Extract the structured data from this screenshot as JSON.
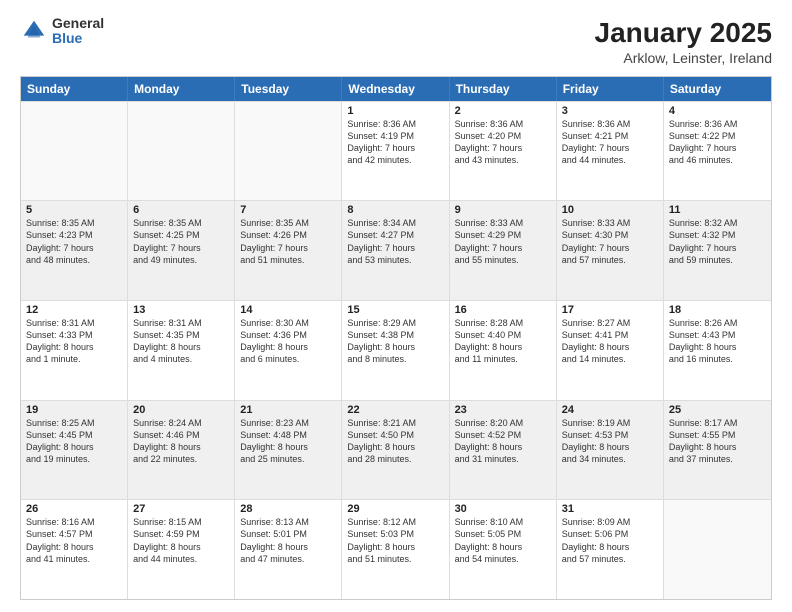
{
  "logo": {
    "general": "General",
    "blue": "Blue"
  },
  "header": {
    "title": "January 2025",
    "subtitle": "Arklow, Leinster, Ireland"
  },
  "weekdays": [
    "Sunday",
    "Monday",
    "Tuesday",
    "Wednesday",
    "Thursday",
    "Friday",
    "Saturday"
  ],
  "rows": [
    [
      {
        "day": "",
        "info": "",
        "empty": true
      },
      {
        "day": "",
        "info": "",
        "empty": true
      },
      {
        "day": "",
        "info": "",
        "empty": true
      },
      {
        "day": "1",
        "info": "Sunrise: 8:36 AM\nSunset: 4:19 PM\nDaylight: 7 hours\nand 42 minutes."
      },
      {
        "day": "2",
        "info": "Sunrise: 8:36 AM\nSunset: 4:20 PM\nDaylight: 7 hours\nand 43 minutes."
      },
      {
        "day": "3",
        "info": "Sunrise: 8:36 AM\nSunset: 4:21 PM\nDaylight: 7 hours\nand 44 minutes."
      },
      {
        "day": "4",
        "info": "Sunrise: 8:36 AM\nSunset: 4:22 PM\nDaylight: 7 hours\nand 46 minutes."
      }
    ],
    [
      {
        "day": "5",
        "info": "Sunrise: 8:35 AM\nSunset: 4:23 PM\nDaylight: 7 hours\nand 48 minutes."
      },
      {
        "day": "6",
        "info": "Sunrise: 8:35 AM\nSunset: 4:25 PM\nDaylight: 7 hours\nand 49 minutes."
      },
      {
        "day": "7",
        "info": "Sunrise: 8:35 AM\nSunset: 4:26 PM\nDaylight: 7 hours\nand 51 minutes."
      },
      {
        "day": "8",
        "info": "Sunrise: 8:34 AM\nSunset: 4:27 PM\nDaylight: 7 hours\nand 53 minutes."
      },
      {
        "day": "9",
        "info": "Sunrise: 8:33 AM\nSunset: 4:29 PM\nDaylight: 7 hours\nand 55 minutes."
      },
      {
        "day": "10",
        "info": "Sunrise: 8:33 AM\nSunset: 4:30 PM\nDaylight: 7 hours\nand 57 minutes."
      },
      {
        "day": "11",
        "info": "Sunrise: 8:32 AM\nSunset: 4:32 PM\nDaylight: 7 hours\nand 59 minutes."
      }
    ],
    [
      {
        "day": "12",
        "info": "Sunrise: 8:31 AM\nSunset: 4:33 PM\nDaylight: 8 hours\nand 1 minute."
      },
      {
        "day": "13",
        "info": "Sunrise: 8:31 AM\nSunset: 4:35 PM\nDaylight: 8 hours\nand 4 minutes."
      },
      {
        "day": "14",
        "info": "Sunrise: 8:30 AM\nSunset: 4:36 PM\nDaylight: 8 hours\nand 6 minutes."
      },
      {
        "day": "15",
        "info": "Sunrise: 8:29 AM\nSunset: 4:38 PM\nDaylight: 8 hours\nand 8 minutes."
      },
      {
        "day": "16",
        "info": "Sunrise: 8:28 AM\nSunset: 4:40 PM\nDaylight: 8 hours\nand 11 minutes."
      },
      {
        "day": "17",
        "info": "Sunrise: 8:27 AM\nSunset: 4:41 PM\nDaylight: 8 hours\nand 14 minutes."
      },
      {
        "day": "18",
        "info": "Sunrise: 8:26 AM\nSunset: 4:43 PM\nDaylight: 8 hours\nand 16 minutes."
      }
    ],
    [
      {
        "day": "19",
        "info": "Sunrise: 8:25 AM\nSunset: 4:45 PM\nDaylight: 8 hours\nand 19 minutes."
      },
      {
        "day": "20",
        "info": "Sunrise: 8:24 AM\nSunset: 4:46 PM\nDaylight: 8 hours\nand 22 minutes."
      },
      {
        "day": "21",
        "info": "Sunrise: 8:23 AM\nSunset: 4:48 PM\nDaylight: 8 hours\nand 25 minutes."
      },
      {
        "day": "22",
        "info": "Sunrise: 8:21 AM\nSunset: 4:50 PM\nDaylight: 8 hours\nand 28 minutes."
      },
      {
        "day": "23",
        "info": "Sunrise: 8:20 AM\nSunset: 4:52 PM\nDaylight: 8 hours\nand 31 minutes."
      },
      {
        "day": "24",
        "info": "Sunrise: 8:19 AM\nSunset: 4:53 PM\nDaylight: 8 hours\nand 34 minutes."
      },
      {
        "day": "25",
        "info": "Sunrise: 8:17 AM\nSunset: 4:55 PM\nDaylight: 8 hours\nand 37 minutes."
      }
    ],
    [
      {
        "day": "26",
        "info": "Sunrise: 8:16 AM\nSunset: 4:57 PM\nDaylight: 8 hours\nand 41 minutes."
      },
      {
        "day": "27",
        "info": "Sunrise: 8:15 AM\nSunset: 4:59 PM\nDaylight: 8 hours\nand 44 minutes."
      },
      {
        "day": "28",
        "info": "Sunrise: 8:13 AM\nSunset: 5:01 PM\nDaylight: 8 hours\nand 47 minutes."
      },
      {
        "day": "29",
        "info": "Sunrise: 8:12 AM\nSunset: 5:03 PM\nDaylight: 8 hours\nand 51 minutes."
      },
      {
        "day": "30",
        "info": "Sunrise: 8:10 AM\nSunset: 5:05 PM\nDaylight: 8 hours\nand 54 minutes."
      },
      {
        "day": "31",
        "info": "Sunrise: 8:09 AM\nSunset: 5:06 PM\nDaylight: 8 hours\nand 57 minutes."
      },
      {
        "day": "",
        "info": "",
        "empty": true
      }
    ]
  ]
}
